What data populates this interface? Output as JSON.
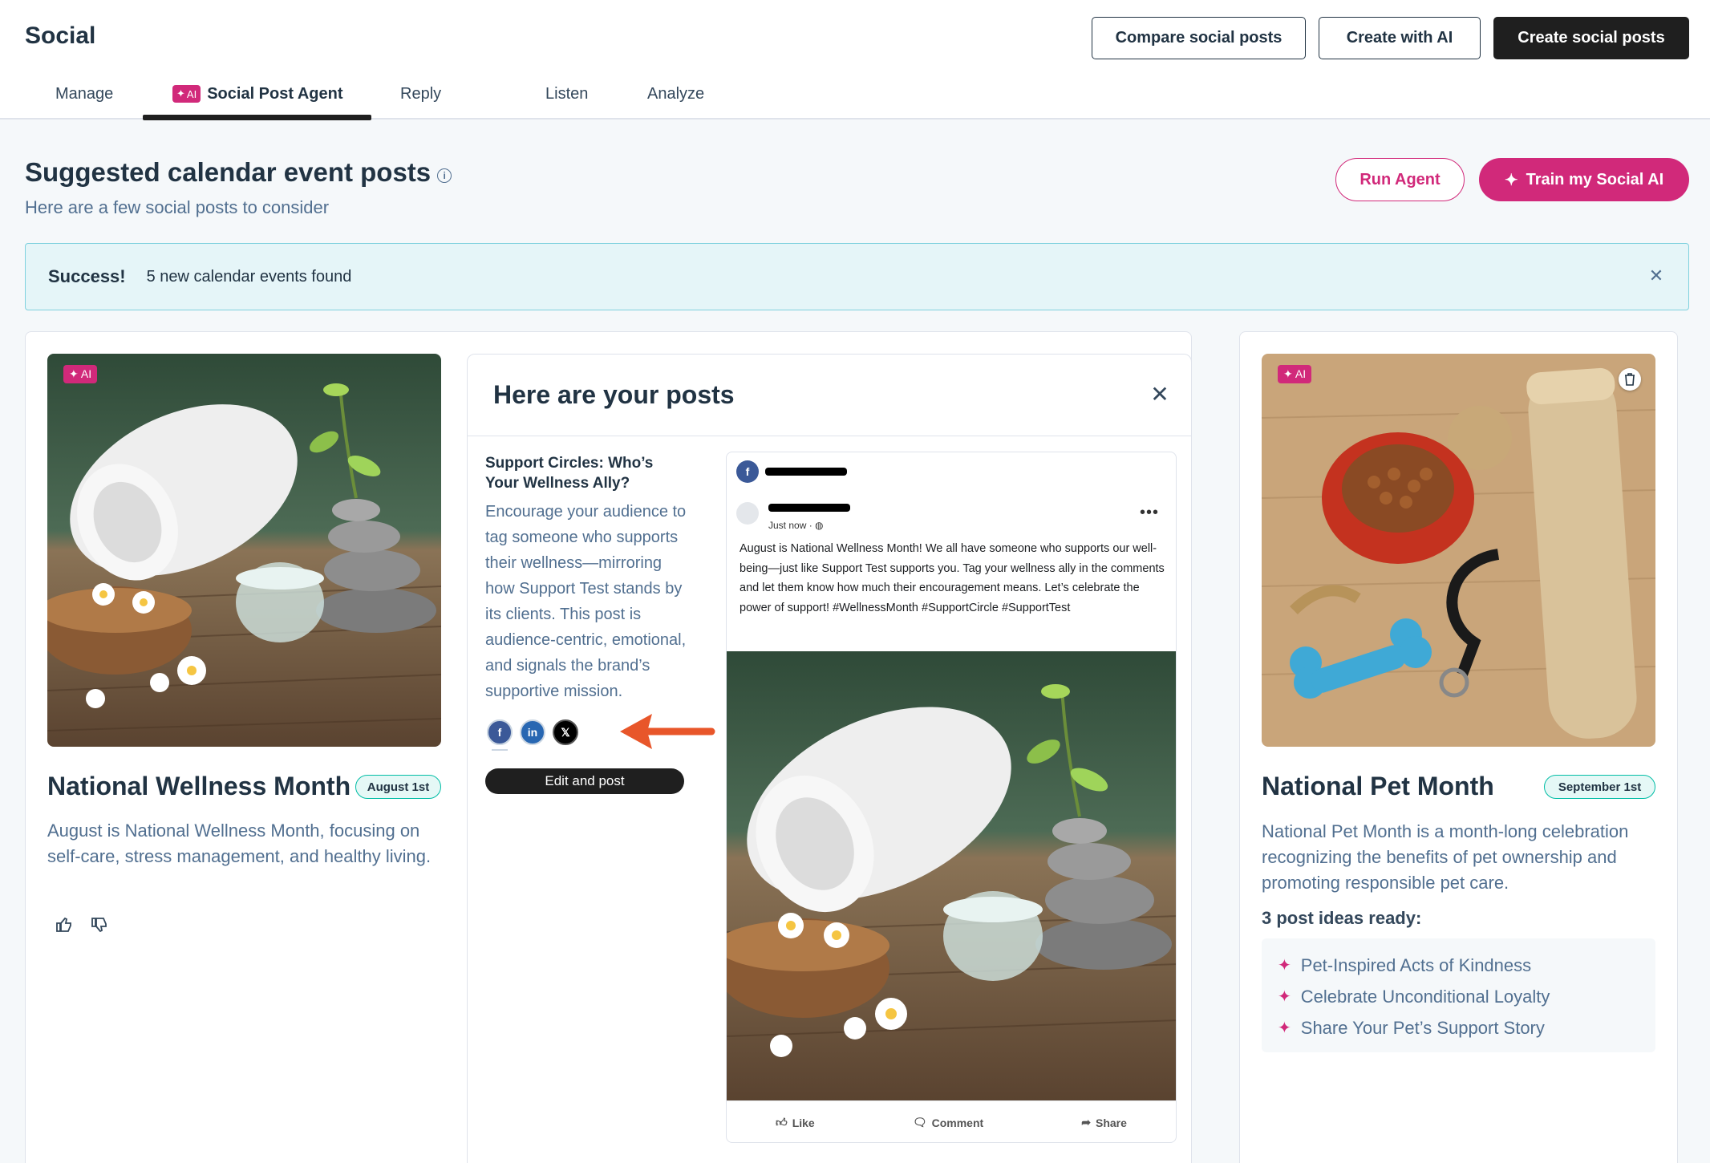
{
  "header": {
    "title": "Social",
    "buttons": {
      "compare": "Compare social posts",
      "create_ai": "Create with AI",
      "create": "Create social posts"
    },
    "tabs": [
      {
        "label": "Manage"
      },
      {
        "label": "Social Post Agent",
        "badge": "AI",
        "active": true
      },
      {
        "label": "Reply"
      },
      {
        "label": "Listen"
      },
      {
        "label": "Analyze"
      }
    ]
  },
  "section": {
    "title": "Suggested calendar event posts",
    "subtitle": "Here are a few social posts to consider",
    "run_agent": "Run Agent",
    "train": "Train my Social AI"
  },
  "alert": {
    "title": "Success!",
    "text": "5 new calendar events found"
  },
  "events": [
    {
      "badge": "AI",
      "title": "National Wellness Month",
      "date": "August 1st",
      "description": "August is National Wellness Month, focusing on self-care, stress management, and healthy living."
    },
    {
      "badge": "AI",
      "title": "National Pet Month",
      "date": "September 1st",
      "description": "National Pet Month is a month-long celebration recognizing the benefits of pet ownership and promoting responsible pet care.",
      "ideas_title": "3 post ideas ready:",
      "ideas": [
        "Pet-Inspired Acts of Kindness",
        "Celebrate Unconditional Loyalty",
        "Share Your Pet’s Support Story"
      ]
    }
  ],
  "panel": {
    "title": "Here are your posts",
    "post_name": "Support Circles: Who’s Your Wellness Ally?",
    "post_description": "Encourage your audience to tag someone who supports their wellness—mirroring how Support Test stands by its clients. This post is audience-centric, emotional, and signals the brand’s supportive mission.",
    "edit_button": "Edit and post",
    "preview": {
      "time": "Just now · ",
      "text": "August is National Wellness Month! We all have someone who supports our well-being—just like Support Test supports you. Tag your wellness ally in the comments and let them know how much their encouragement means. Let’s celebrate the power of support! #WellnessMonth #SupportCircle #SupportTest",
      "actions": {
        "like": "Like",
        "comment": "Comment",
        "share": "Share"
      }
    }
  },
  "colors": {
    "accent": "#d1297a",
    "dark": "#1f1f1f",
    "alert_bg": "#e5f5f8",
    "date_border": "#00bda5"
  }
}
